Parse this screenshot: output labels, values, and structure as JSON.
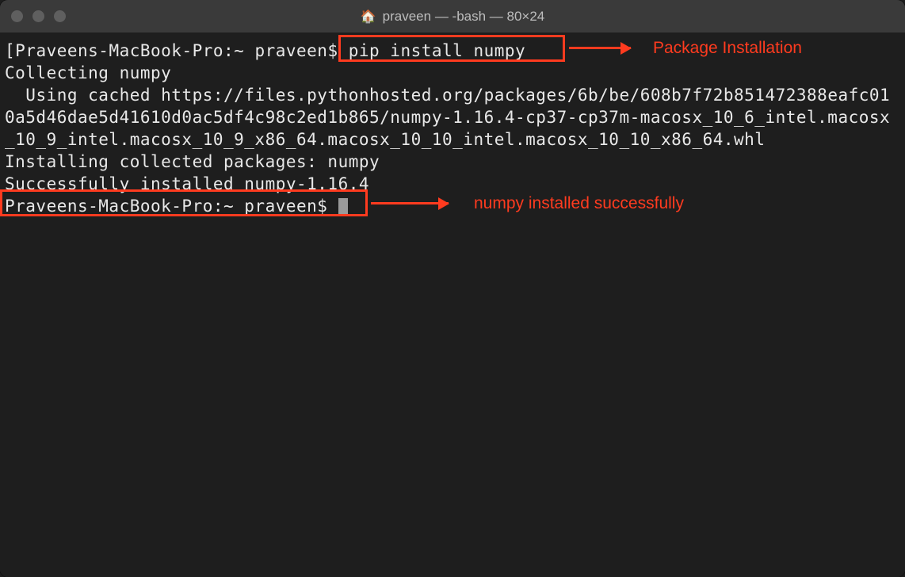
{
  "window": {
    "title": "praveen — -bash — 80×24"
  },
  "terminal": {
    "prompt1_host": "Praveens-MacBook-Pro:~ praveen$ ",
    "command": "pip install numpy",
    "line2": "Collecting numpy",
    "line3": "  Using cached https://files.pythonhosted.org/packages/6b/be/608b7f72b851472388eafc010a5d46dae5d41610d0ac5df4c98c2ed1b865/numpy-1.16.4-cp37-cp37m-macosx_10_6_intel.macosx_10_9_intel.macosx_10_9_x86_64.macosx_10_10_intel.macosx_10_10_x86_64.whl",
    "line4": "Installing collected packages: numpy",
    "line5": "Successfully installed numpy-1.16.4",
    "prompt2": "Praveens-MacBook-Pro:~ praveen$ "
  },
  "annotations": {
    "a1": "Package Installation",
    "a2": "numpy installed successfully"
  },
  "colors": {
    "accent": "#ff3b1f",
    "bg": "#1e1e1e",
    "text": "#e8e8e8"
  }
}
